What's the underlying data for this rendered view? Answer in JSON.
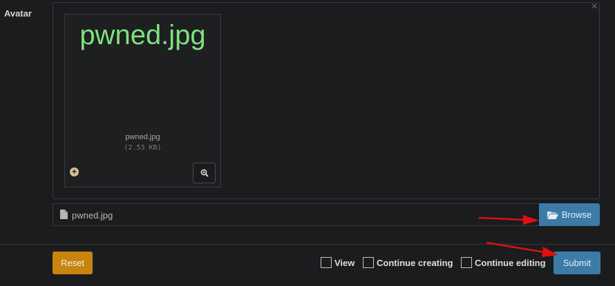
{
  "field": {
    "label": "Avatar"
  },
  "preview": {
    "close_glyph": "×",
    "image_text": "pwned.jpg",
    "caption": "pwned.jpg",
    "size": "(2.53 KB)"
  },
  "file_input": {
    "file_name": "pwned.jpg",
    "browse_label": "Browse"
  },
  "footer": {
    "reset_label": "Reset",
    "view_label": "View",
    "continue_creating_label": "Continue creating",
    "continue_editing_label": "Continue editing",
    "submit_label": "Submit"
  },
  "colors": {
    "primary": "#3c7ba7",
    "warning": "#c7840f",
    "annotation_arrow": "#e01010",
    "preview_text": "#7ee27e"
  },
  "icons": {
    "browse": "folder-open-icon",
    "file": "file-icon",
    "zoom": "zoom-in-icon",
    "add": "plus-circle-icon"
  }
}
